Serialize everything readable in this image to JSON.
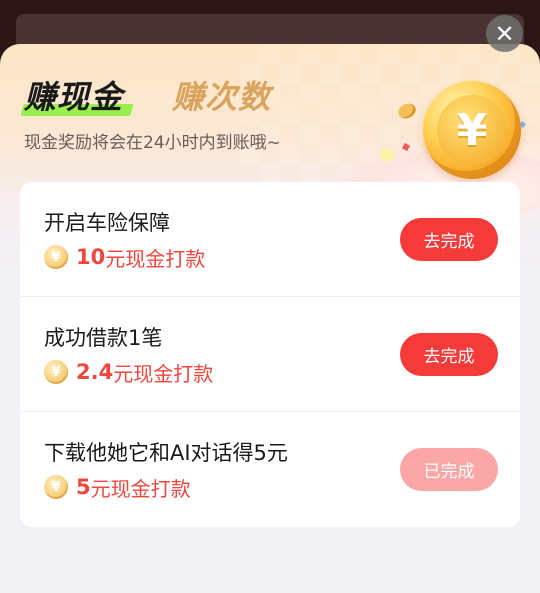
{
  "header": {
    "tab_active": "赚现金",
    "tab_inactive": "赚次数",
    "subtitle": "现金奖励将会在24小时内到账哦~",
    "close_symbol": "✕"
  },
  "coin_symbol": "¥",
  "tasks": [
    {
      "title": "开启车险保障",
      "reward_amount": "10",
      "reward_text": "元现金打款",
      "button_label": "去完成",
      "status": "pending"
    },
    {
      "title": "成功借款1笔",
      "reward_amount": "2.4",
      "reward_text": "元现金打款",
      "button_label": "去完成",
      "status": "pending"
    },
    {
      "title": "下载他她它和AI对话得5元",
      "reward_amount": "5",
      "reward_text": "元现金打款",
      "button_label": "已完成",
      "status": "completed"
    }
  ],
  "colors": {
    "primary_button": "#f53a3a",
    "completed_button": "#fca7a7",
    "reward_text": "#f0463e",
    "tab_inactive": "#d8a45e",
    "tab_underline": "#8ef03e"
  }
}
